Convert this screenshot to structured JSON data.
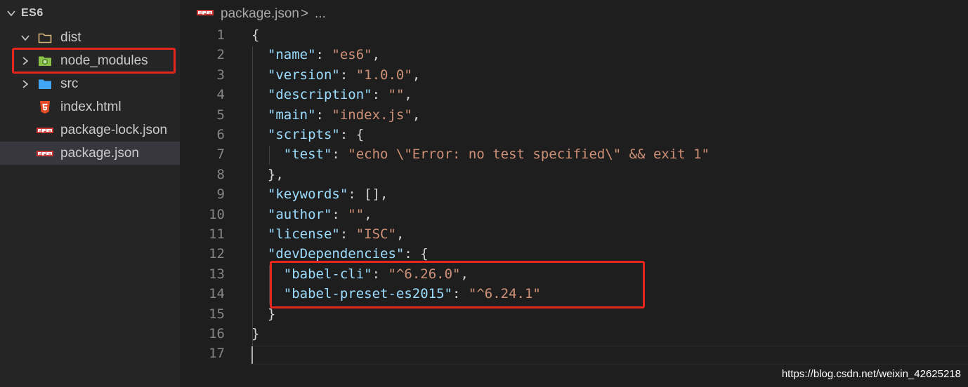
{
  "explorer": {
    "root_label": "ES6",
    "items": [
      {
        "label": "dist",
        "kind": "folder",
        "expanded": true,
        "icon": "folder-outline-icon"
      },
      {
        "label": "node_modules",
        "kind": "folder",
        "expanded": false,
        "icon": "node-folder-icon"
      },
      {
        "label": "src",
        "kind": "folder",
        "expanded": false,
        "icon": "blue-folder-icon"
      },
      {
        "label": "index.html",
        "kind": "file",
        "icon": "html5-icon"
      },
      {
        "label": "package-lock.json",
        "kind": "file",
        "icon": "npm-icon"
      },
      {
        "label": "package.json",
        "kind": "file",
        "icon": "npm-icon",
        "selected": true
      }
    ]
  },
  "breadcrumb": {
    "file": "package.json",
    "separator": ">",
    "more": "..."
  },
  "editor": {
    "lines": [
      {
        "n": "1",
        "indent": "",
        "tokens": [
          [
            "p",
            "{"
          ]
        ]
      },
      {
        "n": "2",
        "indent": "  ",
        "tokens": [
          [
            "k",
            "\"name\""
          ],
          [
            "p",
            ": "
          ],
          [
            "s",
            "\"es6\""
          ],
          [
            "p",
            ","
          ]
        ]
      },
      {
        "n": "3",
        "indent": "  ",
        "tokens": [
          [
            "k",
            "\"version\""
          ],
          [
            "p",
            ": "
          ],
          [
            "s",
            "\"1.0.0\""
          ],
          [
            "p",
            ","
          ]
        ]
      },
      {
        "n": "4",
        "indent": "  ",
        "tokens": [
          [
            "k",
            "\"description\""
          ],
          [
            "p",
            ": "
          ],
          [
            "s",
            "\"\""
          ],
          [
            "p",
            ","
          ]
        ]
      },
      {
        "n": "5",
        "indent": "  ",
        "tokens": [
          [
            "k",
            "\"main\""
          ],
          [
            "p",
            ": "
          ],
          [
            "s",
            "\"index.js\""
          ],
          [
            "p",
            ","
          ]
        ]
      },
      {
        "n": "6",
        "indent": "  ",
        "tokens": [
          [
            "k",
            "\"scripts\""
          ],
          [
            "p",
            ": {"
          ]
        ]
      },
      {
        "n": "7",
        "indent": "    ",
        "tokens": [
          [
            "k",
            "\"test\""
          ],
          [
            "p",
            ": "
          ],
          [
            "s",
            "\"echo \\\"Error: no test specified\\\" && exit 1\""
          ]
        ]
      },
      {
        "n": "8",
        "indent": "  ",
        "tokens": [
          [
            "p",
            "},"
          ]
        ]
      },
      {
        "n": "9",
        "indent": "  ",
        "tokens": [
          [
            "k",
            "\"keywords\""
          ],
          [
            "p",
            ": [],"
          ]
        ]
      },
      {
        "n": "10",
        "indent": "  ",
        "tokens": [
          [
            "k",
            "\"author\""
          ],
          [
            "p",
            ": "
          ],
          [
            "s",
            "\"\""
          ],
          [
            "p",
            ","
          ]
        ]
      },
      {
        "n": "11",
        "indent": "  ",
        "tokens": [
          [
            "k",
            "\"license\""
          ],
          [
            "p",
            ": "
          ],
          [
            "s",
            "\"ISC\""
          ],
          [
            "p",
            ","
          ]
        ]
      },
      {
        "n": "12",
        "indent": "  ",
        "tokens": [
          [
            "k",
            "\"devDependencies\""
          ],
          [
            "p",
            ": {"
          ]
        ]
      },
      {
        "n": "13",
        "indent": "    ",
        "tokens": [
          [
            "k",
            "\"babel-cli\""
          ],
          [
            "p",
            ": "
          ],
          [
            "s",
            "\"^6.26.0\""
          ],
          [
            "p",
            ","
          ]
        ]
      },
      {
        "n": "14",
        "indent": "    ",
        "tokens": [
          [
            "k",
            "\"babel-preset-es2015\""
          ],
          [
            "p",
            ": "
          ],
          [
            "s",
            "\"^6.24.1\""
          ]
        ]
      },
      {
        "n": "15",
        "indent": "  ",
        "tokens": [
          [
            "p",
            "}"
          ]
        ]
      },
      {
        "n": "16",
        "indent": "",
        "tokens": [
          [
            "p",
            "}"
          ]
        ]
      },
      {
        "n": "17",
        "indent": "",
        "tokens": []
      }
    ]
  },
  "watermark": "https://blog.csdn.net/weixin_42625218",
  "colors": {
    "highlight_box": "#e8251d",
    "json_key": "#9cdcfe",
    "json_string": "#ce9178"
  }
}
